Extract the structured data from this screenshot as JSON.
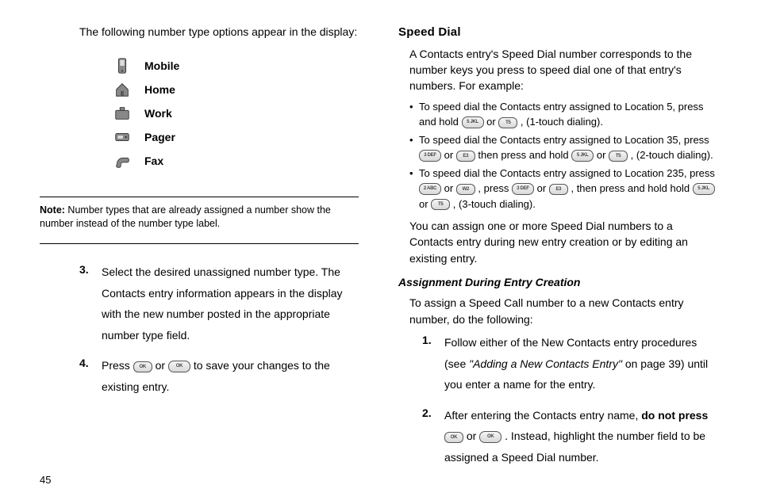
{
  "left": {
    "intro": "The following number type options appear in the display:",
    "types": [
      {
        "name": "mobile-icon",
        "label": "Mobile"
      },
      {
        "name": "home-icon",
        "label": "Home"
      },
      {
        "name": "work-icon",
        "label": "Work"
      },
      {
        "name": "pager-icon",
        "label": "Pager"
      },
      {
        "name": "fax-icon",
        "label": "Fax"
      }
    ],
    "note_label": "Note:",
    "note_text": " Number types that are already assigned a number show the number instead of the number type label.",
    "steps": [
      {
        "num": "3.",
        "body": "Select the desired unassigned number type. The Contacts entry information appears in the display with the new number posted in the appropriate number type field."
      },
      {
        "num": "4.",
        "pre": "Press ",
        "mid": " or ",
        "post": " to save your changes to the existing entry."
      }
    ],
    "page": "45"
  },
  "right": {
    "heading": "Speed Dial",
    "intro": "A Contacts entry's Speed Dial number corresponds to the number keys you press to speed dial one of that entry's numbers. For example:",
    "bullets": [
      {
        "p1": "To speed dial the Contacts entry assigned to Location 5, press and hold ",
        "p2": " or ",
        "p3": ", (1-touch dialing)."
      },
      {
        "p1": "To speed dial the Contacts entry assigned to Location 35, press ",
        "p2": " or ",
        "p3": " then press and hold ",
        "p4": " or ",
        "p5": ", (2-touch dialing)."
      },
      {
        "p1": "To speed dial the Contacts entry assigned to Location 235, press ",
        "p2": " or ",
        "p3": ", press ",
        "p4": " or ",
        "p5": ", then press and hold hold ",
        "p6": " or ",
        "p7": ", (3-touch dialing)."
      }
    ],
    "outro": "You can assign one or more Speed Dial numbers to a Contacts entry during new entry creation or by editing an existing entry.",
    "subheading": "Assignment During Entry Creation",
    "sub_intro": "To assign a Speed Call number to a new Contacts entry number, do the following:",
    "steps": [
      {
        "num": "1.",
        "pre": "Follow either of the New Contacts entry procedures (see ",
        "ref": "\"Adding a New Contacts Entry\"",
        "post": " on page 39) until you enter a name for the entry."
      },
      {
        "num": "2.",
        "pre": "After entering the Contacts entry name, ",
        "bold": "do not press",
        "mid1": " ",
        "mid2": " or ",
        "post": ". Instead, highlight the number field to be assigned a Speed Dial number."
      }
    ]
  },
  "keys": {
    "ok_round": "OK",
    "ok_pill": "OK",
    "k5": "5 JKL",
    "k5s": "T5",
    "k3": "3 DEF",
    "k3s": "E3",
    "k2": "2 ABC",
    "k2s": "W2"
  }
}
